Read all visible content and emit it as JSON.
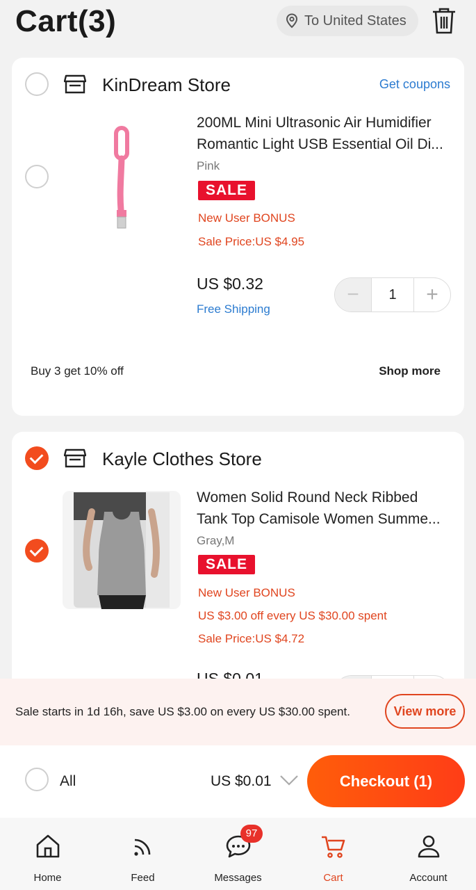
{
  "header": {
    "title": "Cart(3)",
    "ship_to": "To United States"
  },
  "stores": [
    {
      "name": "KinDream Store",
      "coupon_link": "Get coupons",
      "selected": false,
      "product": {
        "name_line1": "200ML Mini Ultrasonic Air Humidifier",
        "name_line2": "Romantic Light USB Essential Oil Di...",
        "variant": "Pink",
        "badge": "SALE",
        "promo1": "New User BONUS",
        "sale_price": "Sale Price:US $4.95",
        "price": "US $0.32",
        "shipping": "Free Shipping",
        "quantity": "1",
        "selected": false
      },
      "footer_offer": "Buy 3 get 10% off",
      "footer_link": "Shop more"
    },
    {
      "name": "Kayle Clothes Store",
      "selected": true,
      "product": {
        "name_line1": "Women Solid Round Neck Ribbed",
        "name_line2": "Tank Top Camisole Women Summe...",
        "variant": "Gray,M",
        "badge": "SALE",
        "promo1": "New User BONUS",
        "promo2": "US $3.00 off every US $30.00 spent",
        "sale_price": "Sale Price:US $4.72",
        "price_partial": "US $0.01",
        "selected": true
      }
    }
  ],
  "banner": {
    "text": "Sale starts in 1d 16h, save US $3.00 on every US $30.00 spent.",
    "button": "View more"
  },
  "checkout_bar": {
    "all_label": "All",
    "total": "US $0.01",
    "checkout_label": "Checkout (1)"
  },
  "nav": {
    "items": [
      {
        "label": "Home",
        "icon": "home-icon"
      },
      {
        "label": "Feed",
        "icon": "feed-icon"
      },
      {
        "label": "Messages",
        "icon": "messages-icon",
        "badge": "97"
      },
      {
        "label": "Cart",
        "icon": "cart-icon",
        "active": true
      },
      {
        "label": "Account",
        "icon": "account-icon"
      }
    ]
  },
  "colors": {
    "accent": "#f24c1e",
    "link": "#2b7bd0",
    "sale_badge": "#e8112d"
  }
}
